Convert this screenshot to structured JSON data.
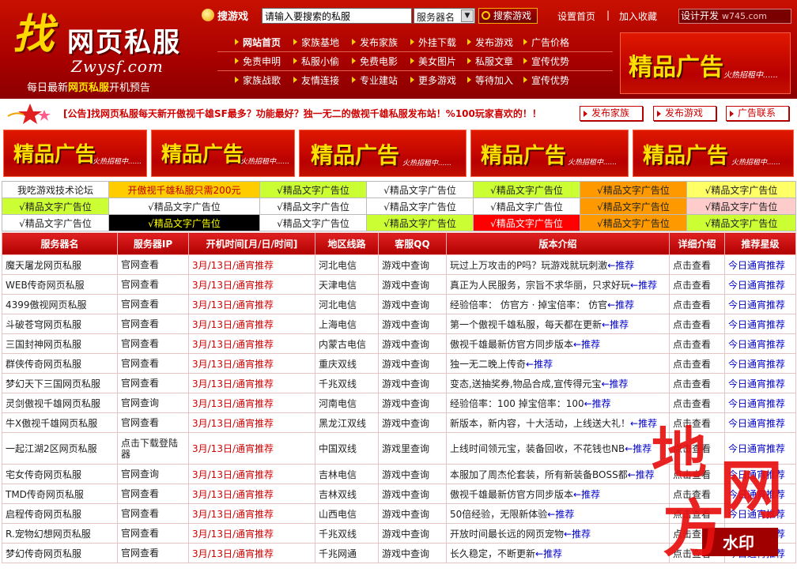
{
  "header": {
    "logo_zhao": "找",
    "logo_name": "网页私服",
    "logo_domain": "Zwysf.com",
    "slogan_pre": "每日最新",
    "slogan_em": "网页私服",
    "slogan_post": "开机预告",
    "search_label": "搜游戏",
    "search_value": "请输入要搜索的私服",
    "server_select": "服务器名",
    "search_button": "搜索游戏",
    "set_home": "设置首页",
    "separator": "|",
    "bookmark": "加入收藏",
    "design_badge": "设计开发",
    "design_site": "w745.com",
    "nav": [
      [
        "网站首页",
        "家族基地",
        "发布家族",
        "外挂下载",
        "发布游戏",
        "广告价格"
      ],
      [
        "免责申明",
        "私服小偷",
        "免费电影",
        "美女图片",
        "私服文章",
        "宣传优势"
      ],
      [
        "家族战歌",
        "友情连接",
        "专业建站",
        "更多游戏",
        "等待加入",
        "宣传优势"
      ]
    ]
  },
  "ad": {
    "big": "精品广告",
    "small": "火热招租中......"
  },
  "notice": {
    "text": "[公告]找网页私服每天新开傲视千雄SF最多？功能最好？独一无二的傲视千雄私服发布站！%100玩家喜欢的！！",
    "buttons": [
      "发布家族",
      "发布游戏",
      "广告联系"
    ]
  },
  "text_ads": [
    [
      {
        "text": "我吃游戏技术论坛",
        "bg": "#ffffff",
        "color": "#222222"
      },
      {
        "text": "开傲视千雄私服只需200元",
        "bg": "#ffcc00",
        "color": "#c00000"
      },
      {
        "text": "√精品文字广告位",
        "bg": "#ccff33",
        "color": "#222222"
      },
      {
        "text": "√精品文字广告位",
        "bg": "#ffffff",
        "color": "#222222"
      },
      {
        "text": "√精品文字广告位",
        "bg": "#ccff33",
        "color": "#222222"
      },
      {
        "text": "√精品文字广告位",
        "bg": "#ff9900",
        "color": "#222222"
      },
      {
        "text": "√精品文字广告位",
        "bg": "#ffff66",
        "color": "#222222"
      }
    ],
    [
      {
        "text": "√精品文字广告位",
        "bg": "#ccff33",
        "color": "#222222"
      },
      {
        "text": "√精品文字广告位",
        "bg": "#ffffff",
        "color": "#222222"
      },
      {
        "text": "√精品文字广告位",
        "bg": "#ffffff",
        "color": "#222222"
      },
      {
        "text": "√精品文字广告位",
        "bg": "#ffffff",
        "color": "#222222"
      },
      {
        "text": "√精品文字广告位",
        "bg": "#ffffff",
        "color": "#222222"
      },
      {
        "text": "√精品文字广告位",
        "bg": "#ff9900",
        "color": "#222222"
      },
      {
        "text": "√精品文字广告位",
        "bg": "#ffcccc",
        "color": "#222222"
      }
    ],
    [
      {
        "text": "√精品文字广告位",
        "bg": "#ffffff",
        "color": "#222222"
      },
      {
        "text": "√精品文字广告位",
        "bg": "#000000",
        "color": "#ffff00"
      },
      {
        "text": "√精品文字广告位",
        "bg": "#ffffff",
        "color": "#222222"
      },
      {
        "text": "√精品文字广告位",
        "bg": "#ccff33",
        "color": "#222222"
      },
      {
        "text": "√精品文字广告位",
        "bg": "#ff0000",
        "color": "#ffffff"
      },
      {
        "text": "√精品文字广告位",
        "bg": "#ff9900",
        "color": "#222222"
      },
      {
        "text": "√精品文字广告位",
        "bg": "#ccff33",
        "color": "#222222"
      }
    ]
  ],
  "table": {
    "headers": [
      "服务器名",
      "服务器IP",
      "开机时间[月/日/时间]",
      "地区线路",
      "客服QQ",
      "版本介绍",
      "详细介绍",
      "推荐星级"
    ],
    "rows": [
      [
        "魔天屠龙网页私服",
        "官网查看",
        "3月/13日/通宵推荐",
        "河北电信",
        "游戏中查询",
        "玩过上万攻击的P吗？玩游戏就玩刺激",
        "←推荐",
        "点击查看",
        "今日通宵推荐"
      ],
      [
        "WEB传奇网页私服",
        "官网查看",
        "3月/13日/通宵推荐",
        "天津电信",
        "游戏中查询",
        "真正为人民服务，宗旨不求华丽，只求好玩",
        "←推荐",
        "点击查看",
        "今日通宵推荐"
      ],
      [
        "4399傲视网页私服",
        "官网查看",
        "3月/13日/通宵推荐",
        "河北电信",
        "游戏中查询",
        "经验倍率： 仿官方 · 掉宝倍率： 仿官",
        "←推荐",
        "点击查看",
        "今日通宵推荐"
      ],
      [
        "斗破苍穹网页私服",
        "官网查看",
        "3月/13日/通宵推荐",
        "上海电信",
        "游戏中查询",
        "第一个傲视千雄私服，每天都在更新",
        "←推荐",
        "点击查看",
        "今日通宵推荐"
      ],
      [
        "三国封神网页私服",
        "官网查看",
        "3月/13日/通宵推荐",
        "内蒙古电信",
        "游戏中查询",
        "傲视千雄最新仿官方同步版本",
        "←推荐",
        "点击查看",
        "今日通宵推荐"
      ],
      [
        "群侠传奇网页私服",
        "官网查看",
        "3月/13日/通宵推荐",
        "重庆双线",
        "游戏中查询",
        "独一无二晚上传奇",
        "←推荐",
        "点击查看",
        "今日通宵推荐"
      ],
      [
        "梦幻天下三国网页私服",
        "官网查看",
        "3月/13日/通宵推荐",
        "千兆双线",
        "游戏中查询",
        "变态,送抽奖券,物品合成,宣传得元宝",
        "←推荐",
        "点击查看",
        "今日通宵推荐"
      ],
      [
        "灵剑傲视千雄网页私服",
        "官网查询",
        "3月/13日/通宵推荐",
        "河南电信",
        "游戏中查询",
        "经验倍率：100 掉宝倍率：100",
        "←推荐",
        "点击查看",
        "今日通宵推荐"
      ],
      [
        "牛X傲视千雄网页私服",
        "官网查看",
        "3月/13日/通宵推荐",
        "黑龙江双线",
        "游戏中查询",
        "新版本，新内容，十大活动，上线送大礼！",
        "←推荐",
        "点击查看",
        "今日通宵推荐"
      ],
      [
        "一起江湖2区网页私服",
        "点击下载登陆器",
        "3月/13日/通宵推荐",
        "中国双线",
        "游戏里查询",
        "上线时间领元宝，装备回收，不花钱也NB",
        "←推荐",
        "点击查看",
        "今日通宵推荐"
      ],
      [
        "宅女传奇网页私服",
        "官网查询",
        "3月/13日/通宵推荐",
        "吉林电信",
        "游戏中查询",
        "本服加了周杰伦套装，所有新装备BOSS都",
        "←推荐",
        "点击查看",
        "今日通宵推荐"
      ],
      [
        "TMD传奇网页私服",
        "官网查看",
        "3月/13日/通宵推荐",
        "吉林双线",
        "游戏中查询",
        "傲视千雄最新仿官方同步版本",
        "←推荐",
        "点击查看",
        "今日通宵推荐"
      ],
      [
        "启程传奇网页私服",
        "官网查看",
        "3月/13日/通宵推荐",
        "山西电信",
        "游戏中查询",
        "50倍经验，无限新体验",
        "←推荐",
        "点击查看",
        "今日通宵推荐"
      ],
      [
        "R.宠物幻想网页私服",
        "官网查看",
        "3月/13日/通宵推荐",
        "千兆双线",
        "游戏中查询",
        "开放时间最长远的网页宠物",
        "←推荐",
        "点击查看",
        "今日通宵推荐"
      ],
      [
        "梦幻传奇网页私服",
        "官网查看",
        "3月/13日/通宵推荐",
        "千兆网通",
        "游戏中查询",
        "长久稳定，不断更新",
        "←推荐",
        "点击查看",
        "今日通宵推荐"
      ]
    ]
  },
  "watermark": {
    "chars": [
      "地",
      "方",
      "网"
    ],
    "tag": "水印"
  },
  "colors": {
    "header_red": "#b00000",
    "accent_yellow": "#ffd800",
    "link_blue": "#0000c8",
    "time_red": "#d00000"
  }
}
